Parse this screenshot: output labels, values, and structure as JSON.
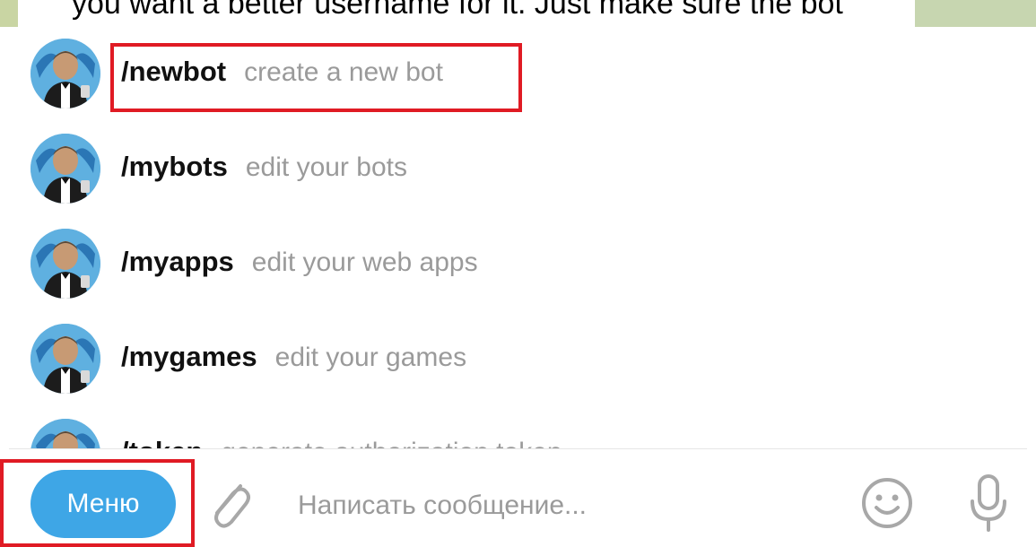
{
  "chat": {
    "partial_message": "you want a better username for it. Just make sure the bot"
  },
  "commands": [
    {
      "name": "/newbot",
      "desc": "create a new bot",
      "highlighted": true
    },
    {
      "name": "/mybots",
      "desc": "edit your bots",
      "highlighted": false
    },
    {
      "name": "/myapps",
      "desc": "edit your web apps",
      "highlighted": false
    },
    {
      "name": "/mygames",
      "desc": "edit your games",
      "highlighted": false
    },
    {
      "name": "/token",
      "desc": "generate authorization token",
      "highlighted": false
    }
  ],
  "input_bar": {
    "menu_label": "Меню",
    "placeholder": "Написать сообщение...",
    "attach_icon": "paperclip-icon",
    "emoji_icon": "smile-icon",
    "mic_icon": "microphone-icon"
  },
  "colors": {
    "accent": "#3ea6e6",
    "highlight": "#e01b24",
    "command_desc": "#9a9a9a"
  }
}
